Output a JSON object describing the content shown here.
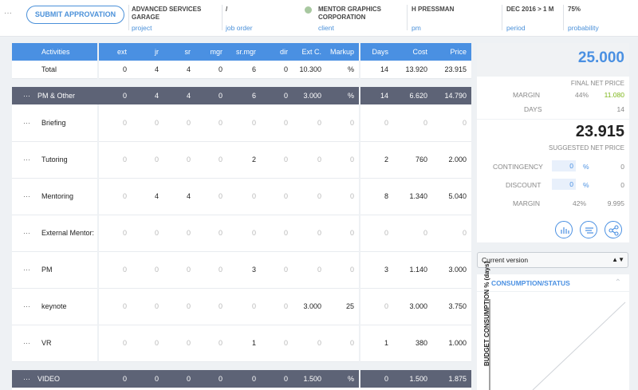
{
  "header": {
    "dots": "···",
    "submit": "SUBMIT APPROVATION",
    "items": [
      {
        "title": "ADVANCED SERVICES GARAGE",
        "link": "project"
      },
      {
        "title": "/",
        "link": "job order"
      },
      {
        "title": "MENTOR GRAPHICS CORPORATION",
        "link": "client"
      },
      {
        "title": "H PRESSMAN",
        "link": "pm"
      },
      {
        "title": "DEC 2016 > 1 M",
        "link": "period"
      },
      {
        "title": "75%",
        "link": "probability"
      }
    ]
  },
  "grid": {
    "columns": [
      "Activities",
      "ext",
      "jr",
      "sr",
      "mgr",
      "sr.mgr",
      "dir",
      "Ext C.",
      "Markup",
      "Days",
      "Cost",
      "Price"
    ],
    "total": {
      "label": "Total",
      "vals": [
        "0",
        "4",
        "4",
        "0",
        "6",
        "0",
        "10.300",
        "%",
        "14",
        "13.920",
        "23.915"
      ]
    },
    "group1": {
      "dots": "···",
      "label": "PM & Other",
      "vals": [
        "0",
        "4",
        "4",
        "0",
        "6",
        "0",
        "3.000",
        "%",
        "14",
        "6.620",
        "14.790"
      ]
    },
    "rows": [
      {
        "dots": "···",
        "label": "Briefing",
        "vals": [
          "0",
          "0",
          "0",
          "0",
          "0",
          "0",
          "0",
          "0",
          "0",
          "0",
          "0"
        ]
      },
      {
        "dots": "···",
        "label": "Tutoring",
        "vals": [
          "0",
          "0",
          "0",
          "0",
          "2",
          "0",
          "0",
          "0",
          "2",
          "760",
          "2.000"
        ]
      },
      {
        "dots": "···",
        "label": "Mentoring",
        "vals": [
          "0",
          "4",
          "4",
          "0",
          "0",
          "0",
          "0",
          "0",
          "8",
          "1.340",
          "5.040"
        ]
      },
      {
        "dots": "···",
        "label": "External Mentor:",
        "vals": [
          "0",
          "0",
          "0",
          "0",
          "0",
          "0",
          "0",
          "0",
          "0",
          "0",
          "0"
        ]
      },
      {
        "dots": "···",
        "label": "PM",
        "vals": [
          "0",
          "0",
          "0",
          "0",
          "3",
          "0",
          "0",
          "0",
          "3",
          "1.140",
          "3.000"
        ]
      },
      {
        "dots": "···",
        "label": "keynote",
        "vals": [
          "0",
          "0",
          "0",
          "0",
          "0",
          "0",
          "3.000",
          "25",
          "0",
          "3.000",
          "3.750"
        ]
      },
      {
        "dots": "···",
        "label": "VR",
        "vals": [
          "0",
          "0",
          "0",
          "0",
          "1",
          "0",
          "0",
          "0",
          "1",
          "380",
          "1.000"
        ]
      }
    ],
    "group2": {
      "dots": "···",
      "label": "VIDEO",
      "vals": [
        "0",
        "0",
        "0",
        "0",
        "0",
        "0",
        "1.500",
        "%",
        "0",
        "1.500",
        "1.875"
      ]
    }
  },
  "panel": {
    "final_value": "25.000",
    "final_caption": "FINAL NET PRICE",
    "margin_label": "MARGIN",
    "margin_pct": "44%",
    "margin_val": "11.080",
    "days_label": "DAYS",
    "days_val": "14",
    "suggested_value": "23.915",
    "suggested_caption": "SUGGESTED NET PRICE",
    "contingency_label": "CONTINGENCY",
    "contingency_input": "0",
    "contingency_unit": "%",
    "contingency_val": "0",
    "discount_label": "DISCOUNT",
    "discount_input": "0",
    "discount_unit": "%",
    "discount_val": "0",
    "margin2_label": "MARGIN",
    "margin2_pct": "42%",
    "margin2_val": "9.995",
    "icons": [
      "chart-icon",
      "list-icon",
      "share-icon"
    ]
  },
  "version": {
    "selected": "Current version"
  },
  "consumption": {
    "title": "CONSUMPTION/STATUS",
    "ylabel": "BUDGET CONSUMPTION % (days)"
  }
}
